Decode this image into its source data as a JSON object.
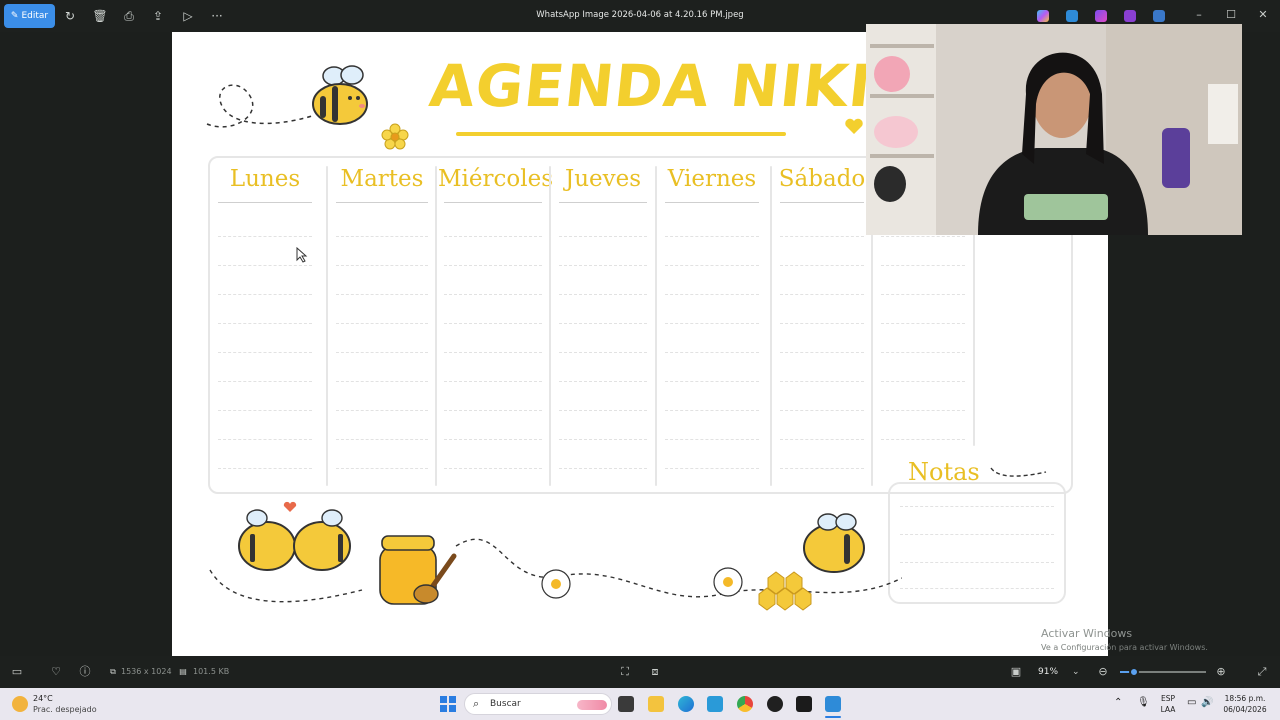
{
  "toolbar": {
    "edit_label": "Editar",
    "file_title": "WhatsApp Image 2026-04-06 at 4.20.16 PM.jpeg",
    "more_label": "···"
  },
  "planner": {
    "title": "AGENDA NIKI",
    "days": [
      "Lunes",
      "Martes",
      "Miércoles",
      "Jueves",
      "Viernes",
      "Sábado"
    ],
    "notes_title": "Notas",
    "accent_color": "#f3cf2e",
    "label_color": "#e9bf24"
  },
  "watermark": {
    "title": "Activar Windows",
    "subtitle": "Ve a Configuración para activar Windows."
  },
  "statusbar": {
    "dimensions": "1536 x 1024",
    "file_size": "101.5 KB",
    "zoom": "91%",
    "zoom_value": 0.16
  },
  "taskbar": {
    "temperature": "24°C",
    "weather": "Prac. despejado",
    "search_placeholder": "Buscar",
    "language": "ESP",
    "layout": "LAA",
    "time": "18:56 p.m.",
    "date": "06/04/2026"
  },
  "colors": {
    "app_accent": "#3b8ee8",
    "toolbar_bg": "#1d201e",
    "taskbar_bg": "#e9e7ef"
  }
}
